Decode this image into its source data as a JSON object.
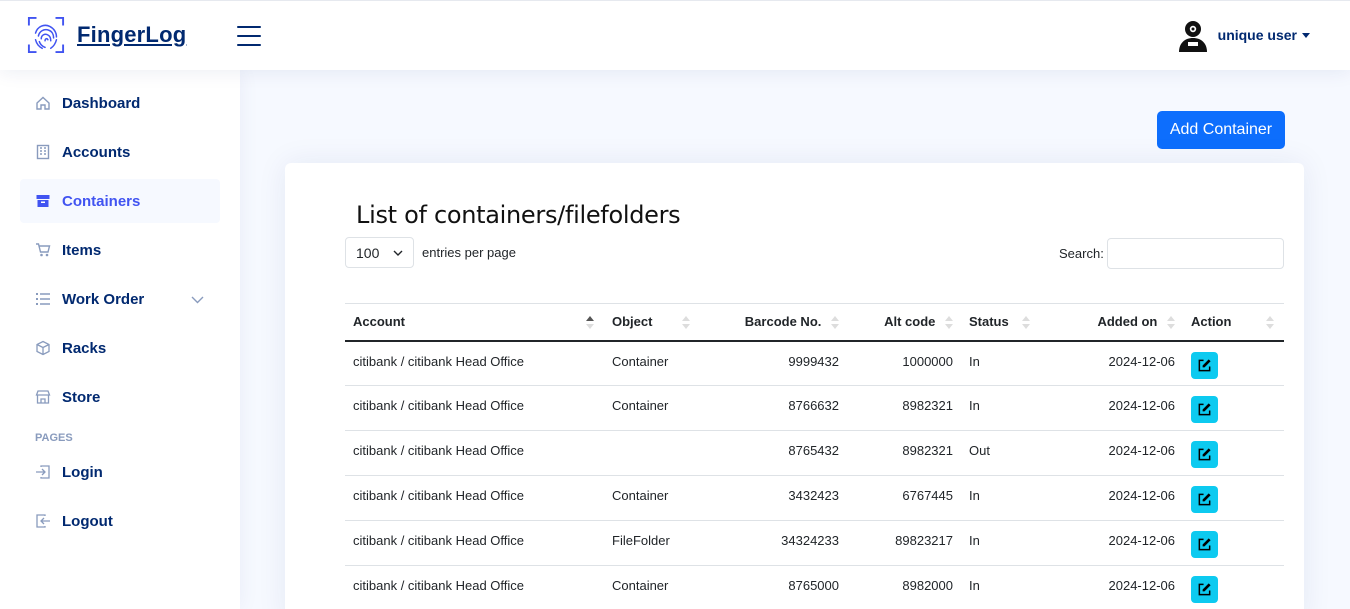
{
  "app": {
    "name": "FingerLog",
    "user_name": "unique user"
  },
  "sidebar": {
    "items": [
      {
        "label": "Dashboard",
        "icon": "house-icon",
        "active": false
      },
      {
        "label": "Accounts",
        "icon": "building-icon",
        "active": false
      },
      {
        "label": "Containers",
        "icon": "archive-box-icon",
        "active": true
      },
      {
        "label": "Items",
        "icon": "cart-icon",
        "active": false
      },
      {
        "label": "Work Order",
        "icon": "list-icon",
        "active": false,
        "expandable": true
      },
      {
        "label": "Racks",
        "icon": "box-icon",
        "active": false
      },
      {
        "label": "Store",
        "icon": "shop-icon",
        "active": false
      }
    ],
    "pages_heading": "PAGES",
    "pages": [
      {
        "label": "Login",
        "icon": "login-icon"
      },
      {
        "label": "Logout",
        "icon": "logout-icon"
      }
    ]
  },
  "main": {
    "add_button": "Add Container",
    "title": "List of containers/filefolders",
    "per_page_value": "100",
    "per_page_label": "entries per page",
    "search_label": "Search:",
    "search_value": "",
    "columns": [
      "Account",
      "Object",
      "Barcode No.",
      "Alt code",
      "Status",
      "Added on",
      "Action"
    ],
    "sorted_column": "Account",
    "sort_direction": "ascending",
    "rows": [
      {
        "account": "citibank / citibank Head Office",
        "object": "Container",
        "barcode": "9999432",
        "alt_code": "1000000",
        "status": "In",
        "added_on": "2024-12-06"
      },
      {
        "account": "citibank / citibank Head Office",
        "object": "Container",
        "barcode": "8766632",
        "alt_code": "8982321",
        "status": "In",
        "added_on": "2024-12-06"
      },
      {
        "account": "citibank / citibank Head Office",
        "object": "",
        "barcode": "8765432",
        "alt_code": "8982321",
        "status": "Out",
        "added_on": "2024-12-06"
      },
      {
        "account": "citibank / citibank Head Office",
        "object": "Container",
        "barcode": "3432423",
        "alt_code": "6767445",
        "status": "In",
        "added_on": "2024-12-06"
      },
      {
        "account": "citibank / citibank Head Office",
        "object": "FileFolder",
        "barcode": "34324233",
        "alt_code": "89823217",
        "status": "In",
        "added_on": "2024-12-06"
      },
      {
        "account": "citibank / citibank Head Office",
        "object": "Container",
        "barcode": "8765000",
        "alt_code": "8982000",
        "status": "In",
        "added_on": "2024-12-06"
      }
    ]
  },
  "colors": {
    "primary_text": "#012970",
    "active_link": "#4154f1",
    "button": "#0d6efd",
    "edit_button": "#0dcaf0"
  }
}
